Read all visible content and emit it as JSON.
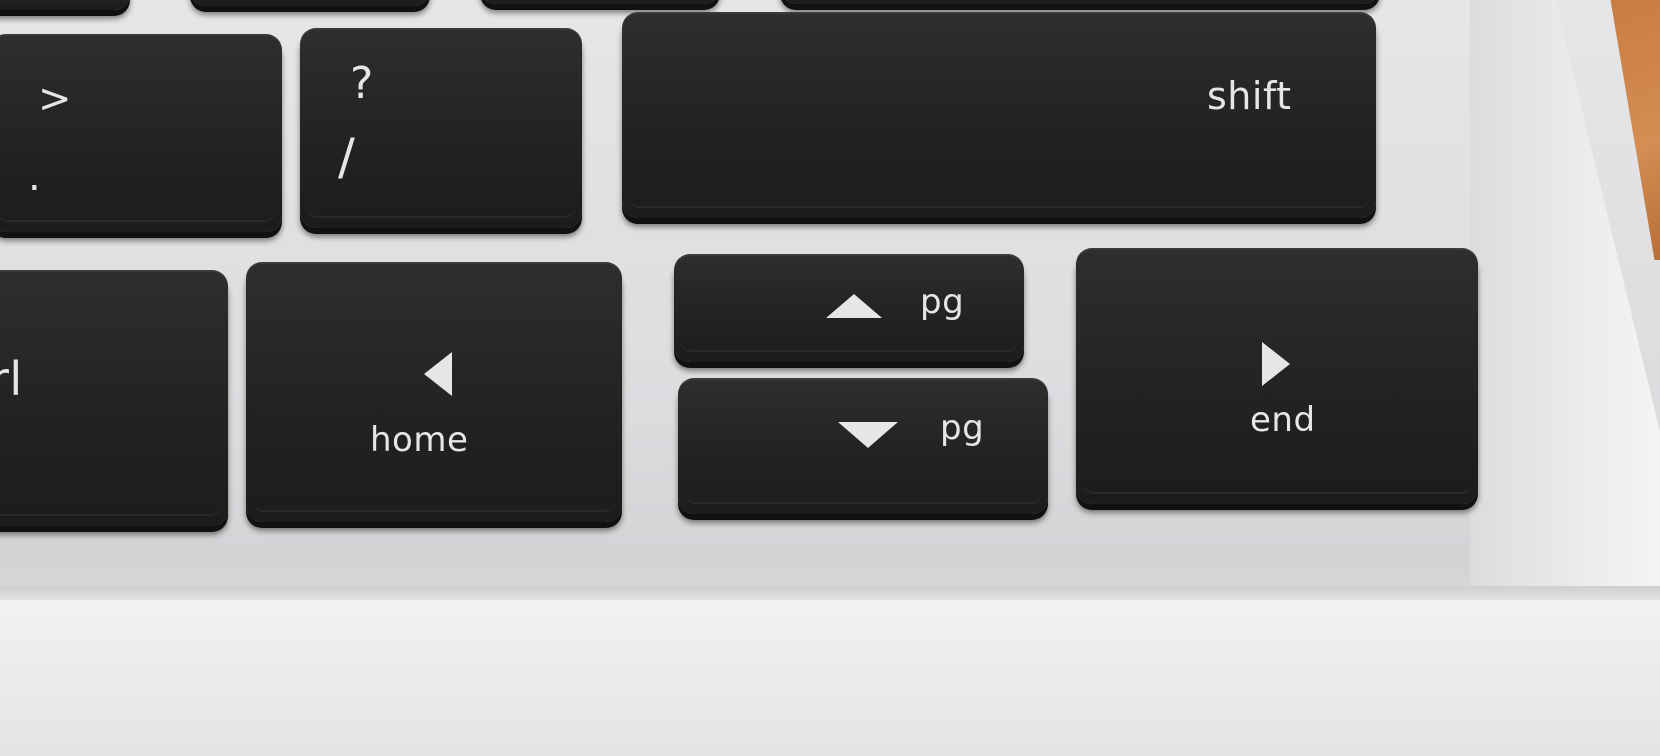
{
  "keyboard": {
    "row_top": {
      "period_key": {
        "upper": ">",
        "lower": "."
      },
      "slash_key": {
        "upper": "?",
        "lower": "/"
      },
      "shift_key": {
        "label": "shift"
      }
    },
    "row_bottom": {
      "ctrl_key": {
        "label": "rl"
      },
      "home_key": {
        "label": "home",
        "icon": "triangle-left-icon"
      },
      "pg_up_key": {
        "label": "pg",
        "icon": "triangle-up-icon"
      },
      "pg_down_key": {
        "label": "pg",
        "icon": "triangle-down-icon"
      },
      "end_key": {
        "label": "end",
        "icon": "triangle-right-icon"
      }
    }
  },
  "colors": {
    "key": "#232325",
    "legend": "#e6e6e6",
    "deck": "#dcdcdf",
    "table": "#c87a3e"
  }
}
